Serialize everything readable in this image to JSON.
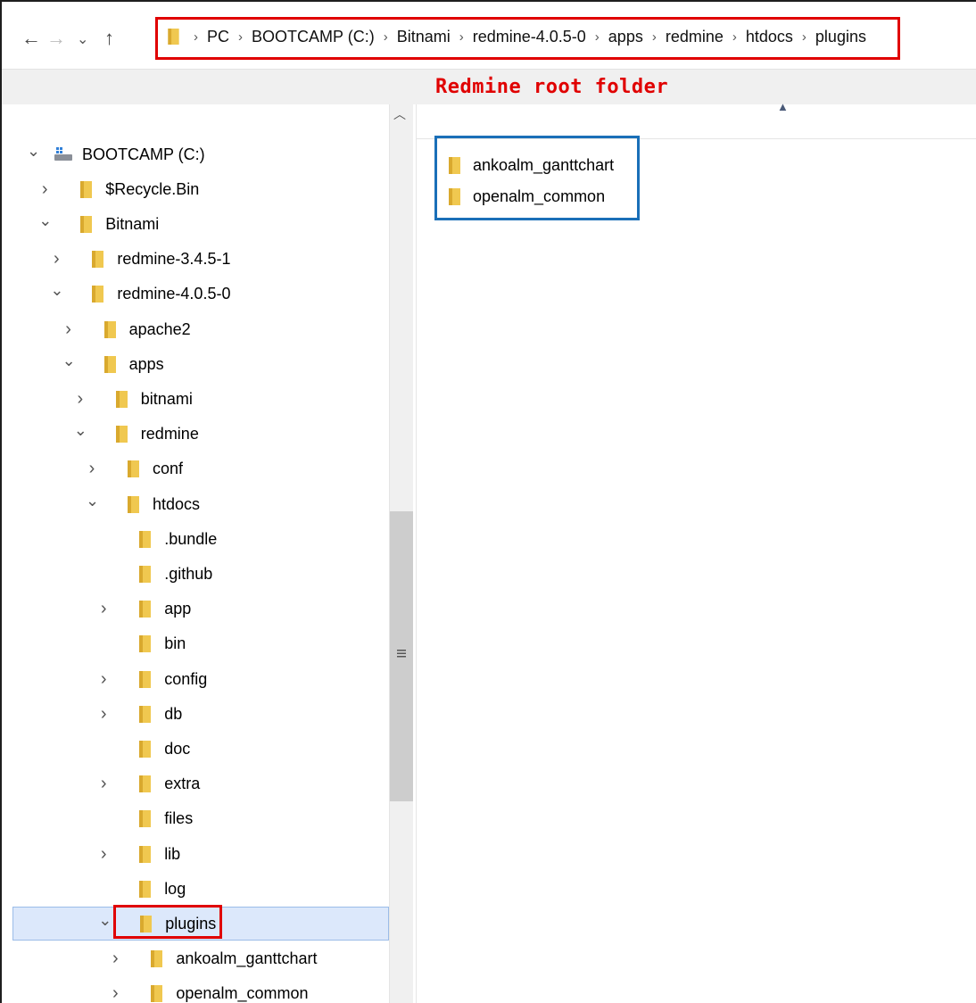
{
  "nav": {
    "back_icon": "←",
    "forward_icon": "→",
    "recent_icon": "⌄",
    "up_icon": "↑"
  },
  "breadcrumb": [
    "PC",
    "BOOTCAMP (C:)",
    "Bitnami",
    "redmine-4.0.5-0",
    "apps",
    "redmine",
    "htdocs",
    "plugins"
  ],
  "annotation": "Redmine root folder",
  "tree": [
    {
      "label": "BOOTCAMP (C:)",
      "level": 0,
      "chevron": "expanded",
      "icon": "drive-icon"
    },
    {
      "label": "$Recycle.Bin",
      "level": 1,
      "chevron": "collapsed",
      "icon": "folder-icon"
    },
    {
      "label": "Bitnami",
      "level": 1,
      "chevron": "expanded",
      "icon": "folder-icon"
    },
    {
      "label": "redmine-3.4.5-1",
      "level": 2,
      "chevron": "collapsed",
      "icon": "folder-icon"
    },
    {
      "label": "redmine-4.0.5-0",
      "level": 2,
      "chevron": "expanded",
      "icon": "folder-icon"
    },
    {
      "label": "apache2",
      "level": 3,
      "chevron": "collapsed",
      "icon": "folder-icon"
    },
    {
      "label": "apps",
      "level": 3,
      "chevron": "expanded",
      "icon": "folder-icon"
    },
    {
      "label": "bitnami",
      "level": 4,
      "chevron": "collapsed",
      "icon": "folder-icon"
    },
    {
      "label": "redmine",
      "level": 4,
      "chevron": "expanded",
      "icon": "folder-icon"
    },
    {
      "label": "conf",
      "level": 5,
      "chevron": "collapsed",
      "icon": "folder-icon"
    },
    {
      "label": "htdocs",
      "level": 5,
      "chevron": "expanded",
      "icon": "folder-icon"
    },
    {
      "label": ".bundle",
      "level": 6,
      "chevron": "none",
      "icon": "folder-icon"
    },
    {
      "label": ".github",
      "level": 6,
      "chevron": "none",
      "icon": "folder-icon"
    },
    {
      "label": "app",
      "level": 6,
      "chevron": "collapsed",
      "icon": "folder-icon"
    },
    {
      "label": "bin",
      "level": 6,
      "chevron": "none",
      "icon": "folder-icon"
    },
    {
      "label": "config",
      "level": 6,
      "chevron": "collapsed",
      "icon": "folder-icon"
    },
    {
      "label": "db",
      "level": 6,
      "chevron": "collapsed",
      "icon": "folder-icon"
    },
    {
      "label": "doc",
      "level": 6,
      "chevron": "none",
      "icon": "folder-icon"
    },
    {
      "label": "extra",
      "level": 6,
      "chevron": "collapsed",
      "icon": "folder-icon"
    },
    {
      "label": "files",
      "level": 6,
      "chevron": "none",
      "icon": "folder-icon"
    },
    {
      "label": "lib",
      "level": 6,
      "chevron": "collapsed",
      "icon": "folder-icon"
    },
    {
      "label": "log",
      "level": 6,
      "chevron": "none",
      "icon": "folder-icon"
    },
    {
      "label": "plugins",
      "level": 6,
      "chevron": "expanded",
      "icon": "folder-icon",
      "selected": true
    },
    {
      "label": "ankoalm_ganttchart",
      "level": 7,
      "chevron": "collapsed",
      "icon": "folder-icon"
    },
    {
      "label": "openalm_common",
      "level": 7,
      "chevron": "collapsed",
      "icon": "folder-icon"
    }
  ],
  "files": [
    {
      "name": "ankoalm_ganttchart"
    },
    {
      "name": "openalm_common"
    }
  ],
  "colors": {
    "folder": "#f0c850",
    "selection": "#dce8fb",
    "highlight_red": "#e00000",
    "highlight_blue": "#1a6fb8"
  }
}
